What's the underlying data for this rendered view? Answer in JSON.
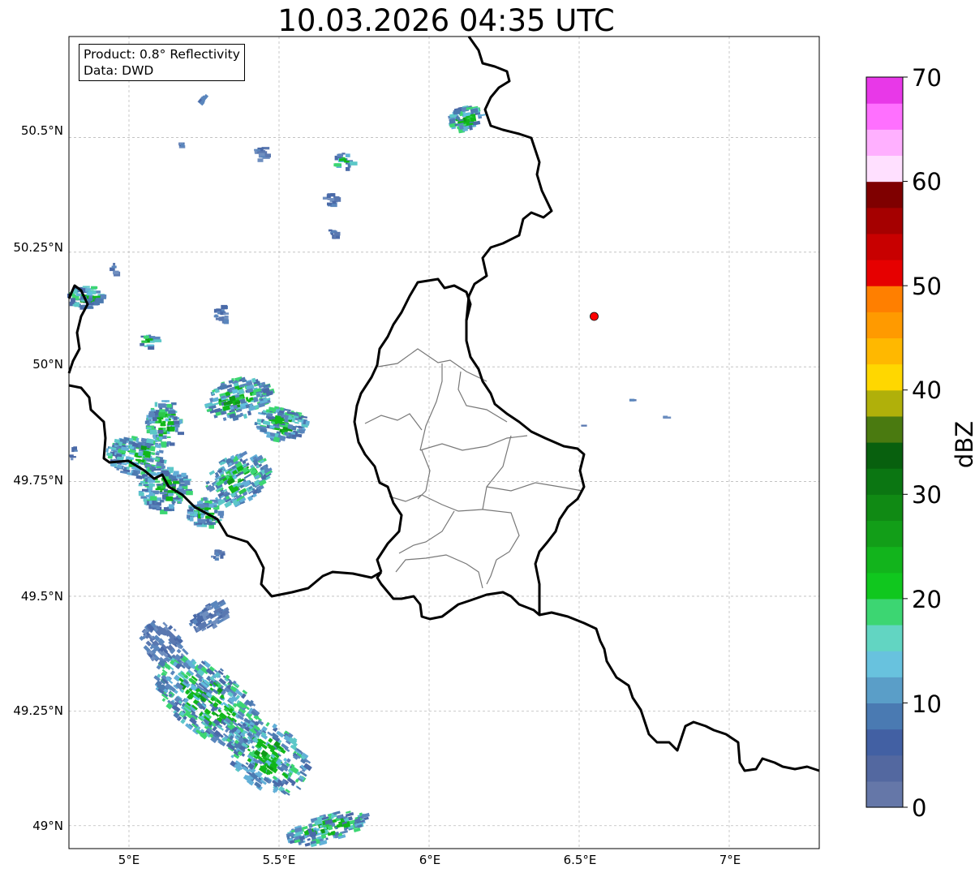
{
  "title": "10.03.2026 04:35 UTC",
  "info": {
    "product": "Product: 0.8° Reflectivity",
    "data": "Data: DWD"
  },
  "map": {
    "extent": {
      "lon_min": 4.8,
      "lon_max": 7.3,
      "lat_min": 48.95,
      "lat_max": 50.72
    },
    "lat_ticks": [
      {
        "value": 50.5,
        "label": "50.5°N"
      },
      {
        "value": 50.25,
        "label": "50.25°N"
      },
      {
        "value": 50.0,
        "label": "50°N"
      },
      {
        "value": 49.75,
        "label": "49.75°N"
      },
      {
        "value": 49.5,
        "label": "49.5°N"
      },
      {
        "value": 49.25,
        "label": "49.25°N"
      },
      {
        "value": 49.0,
        "label": "49°N"
      }
    ],
    "lon_ticks": [
      {
        "value": 5.0,
        "label": "5°E"
      },
      {
        "value": 5.5,
        "label": "5.5°E"
      },
      {
        "value": 6.0,
        "label": "6°E"
      },
      {
        "value": 6.5,
        "label": "6.5°E"
      },
      {
        "value": 7.0,
        "label": "7°E"
      }
    ],
    "gridlines": true,
    "radar_site": {
      "lon": 6.55,
      "lat": 50.11,
      "color": "#ff0000"
    }
  },
  "colorbar": {
    "label": "dBZ",
    "min": 0,
    "max": 70,
    "step": 2.5,
    "ticks": [
      "0",
      "10",
      "20",
      "30",
      "40",
      "50",
      "60",
      "70"
    ],
    "colors": [
      "#6577a8",
      "#5368a0",
      "#4260a3",
      "#4a7ab2",
      "#5a9ec8",
      "#68c2de",
      "#62d5c2",
      "#3cd672",
      "#10c71e",
      "#12b41c",
      "#129e18",
      "#108a14",
      "#0b7612",
      "#08600e",
      "#4a7a10",
      "#b0b00a",
      "#ffd700",
      "#ffb800",
      "#ff9a00",
      "#ff7f00",
      "#e60000",
      "#c80000",
      "#a50000",
      "#7f0000",
      "#ffe0ff",
      "#ffb0ff",
      "#ff70ff",
      "#e838e8"
    ]
  }
}
